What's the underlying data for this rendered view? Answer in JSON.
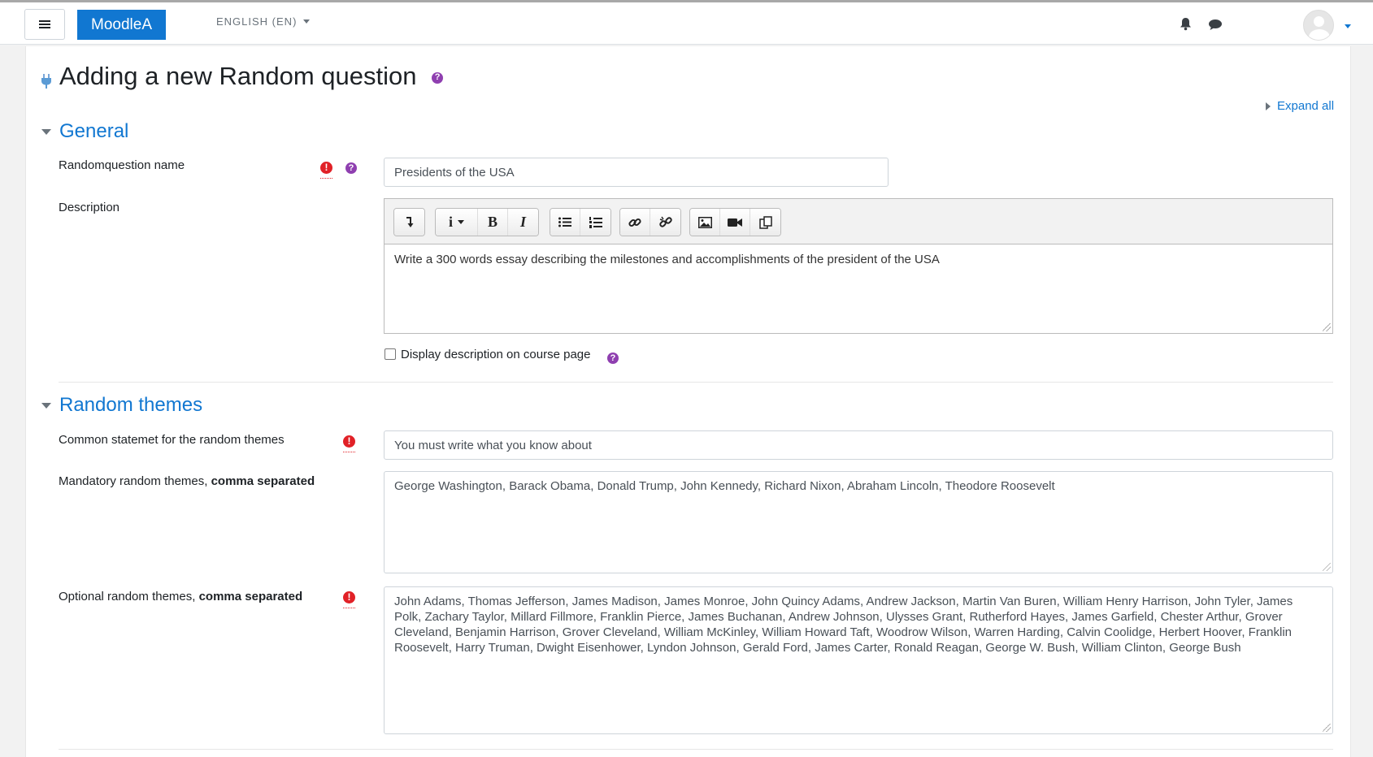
{
  "navbar": {
    "brand": "MoodleA",
    "language": "ENGLISH (EN)"
  },
  "page": {
    "title": "Adding a new Random question",
    "expand_all": "Expand all"
  },
  "sections": {
    "general": {
      "title": "General",
      "name_label": "Randomquestion name",
      "name_value": "Presidents of the USA",
      "description_label": "Description",
      "description_value": "Write a 300 words essay describing the milestones and accomplishments of the president of the USA",
      "display_checkbox_label": "Display description on course page",
      "display_checkbox_checked": false
    },
    "random_themes": {
      "title": "Random themes",
      "common_label": "Common statemet for the random themes",
      "common_value": "You must write what you know about",
      "mandatory_label": "Mandatory random themes, ",
      "mandatory_label_bold": "comma separated",
      "mandatory_value": "George Washington, Barack Obama, Donald Trump, John Kennedy, Richard Nixon, Abraham Lincoln, Theodore Roosevelt",
      "optional_label": "Optional random themes, ",
      "optional_label_bold": "comma separated",
      "optional_value": "John Adams, Thomas Jefferson, James Madison, James Monroe, John Quincy Adams, Andrew Jackson, Martin Van Buren, William Henry Harrison, John Tyler, James Polk, Zachary Taylor, Millard Fillmore, Franklin Pierce, James Buchanan, Andrew Johnson, Ulysses Grant, Rutherford Hayes, James Garfield, Chester Arthur, Grover Cleveland, Benjamin Harrison, Grover Cleveland, William McKinley, William Howard Taft, Woodrow Wilson, Warren Harding, Calvin Coolidge, Herbert Hoover, Franklin Roosevelt, Harry Truman, Dwight Eisenhower, Lyndon Johnson, Gerald Ford, James Carter, Ronald Reagan, George W. Bush, William Clinton, George Bush"
    }
  },
  "editor_toolbar": {
    "groups": [
      [
        "collapse-icon"
      ],
      [
        "info-style-icon",
        "bold-icon",
        "italic-icon"
      ],
      [
        "bullet-list-icon",
        "numbered-list-icon"
      ],
      [
        "link-icon",
        "unlink-icon"
      ],
      [
        "image-icon",
        "video-icon",
        "manage-files-icon"
      ]
    ]
  },
  "colors": {
    "brand": "#1177d1",
    "link": "#1177d1",
    "help": "#8f3fb0",
    "required": "#e12127"
  }
}
